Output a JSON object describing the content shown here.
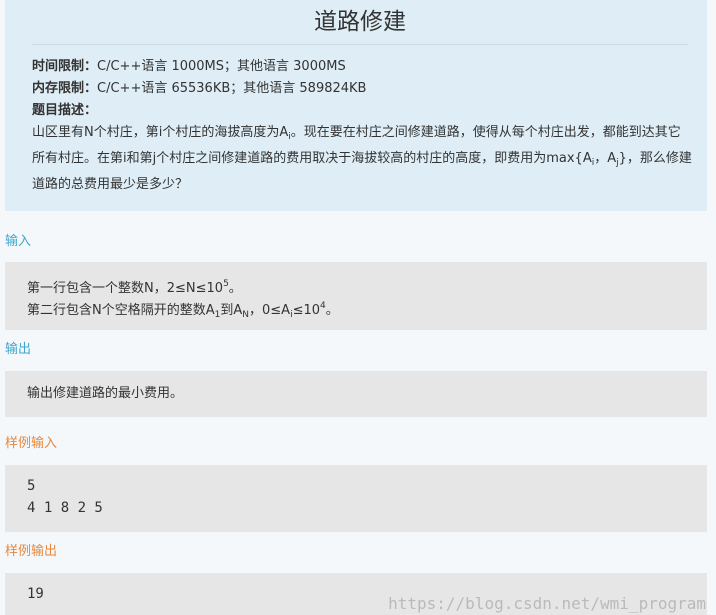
{
  "problem": {
    "title": "道路修建",
    "time_limit_label": "时间限制：",
    "time_limit_value": "C/C++语言 1000MS；其他语言 3000MS",
    "memory_limit_label": "内存限制：",
    "memory_limit_value": "C/C++语言 65536KB；其他语言 589824KB",
    "description_label": "题目描述：",
    "description": {
      "p1": "山区里有N个村庄，第i个村庄的海拔高度为A",
      "p1_sub": "i",
      "p2": "。现在要在村庄之间修建道路，使得从每个村庄出发，都能到达其它所有村庄。在第i和第j个村庄之间修建道路的费用取决于海拔较高的村庄的高度，即费用为max{A",
      "p2_sub_i": "i",
      "p3": "，A",
      "p3_sub_j": "j",
      "p4": "}，那么修建道路的总费用最少是多少？"
    }
  },
  "input_section": {
    "label": "输入",
    "line1_text": "第一行包含一个整数N，2≤N≤10",
    "line1_sup": "5",
    "line1_end": "。",
    "line2_text_a": "第二行包含N个空格隔开的整数A",
    "line2_sub_1": "1",
    "line2_text_b": "到A",
    "line2_sub_n": "N",
    "line2_text_c": "，0≤A",
    "line2_sub_i": "i",
    "line2_text_d": "≤10",
    "line2_sup": "4",
    "line2_end": "。"
  },
  "output_section": {
    "label": "输出",
    "text": "输出修建道路的最小费用。"
  },
  "sample_input": {
    "label": "样例输入",
    "line1": "5",
    "line2": "4 1 8 2 5"
  },
  "sample_output": {
    "label": "样例输出",
    "value": "19"
  },
  "watermark": "https://blog.csdn.net/wmi_program",
  "colors": {
    "header_bg": "#deedf6",
    "content_bg": "#e6e6e6",
    "section_blue": "#3ea6cf",
    "section_orange": "#e8873a"
  }
}
